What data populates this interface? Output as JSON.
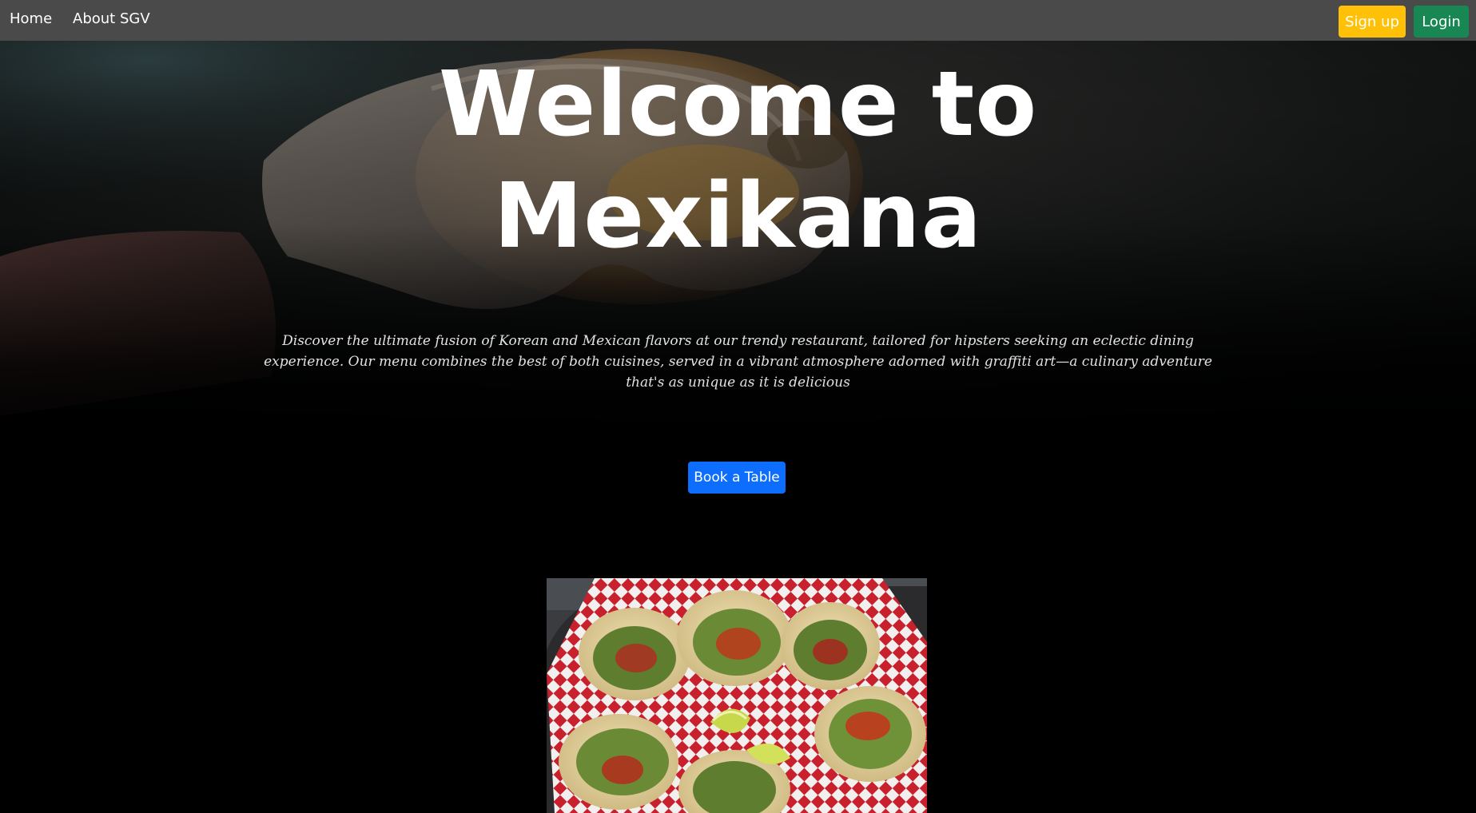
{
  "navbar": {
    "links": [
      {
        "label": "Home"
      },
      {
        "label": "About SGV"
      }
    ],
    "signup_label": "Sign up",
    "login_label": "Login",
    "background": "#4a4a4a",
    "signup_color": "#ffc107",
    "login_color": "#198754"
  },
  "hero": {
    "title_line1": "Welcome to",
    "title_line2": "Mexikana",
    "description": "Discover the ultimate fusion of Korean and Mexican flavors at our trendy restaurant, tailored for hipsters seeking an eclectic dining experience. Our menu combines the best of both cuisines, served in a vibrant atmosphere adorned with graffiti art—a culinary adventure that's as unique as it is delicious",
    "background_image": "hand-holding-taco-photo"
  },
  "booking": {
    "button_label": "Book a Table",
    "button_color": "#0d6efd"
  },
  "gallery": {
    "image": "tacos-on-checkered-paper-photo"
  }
}
